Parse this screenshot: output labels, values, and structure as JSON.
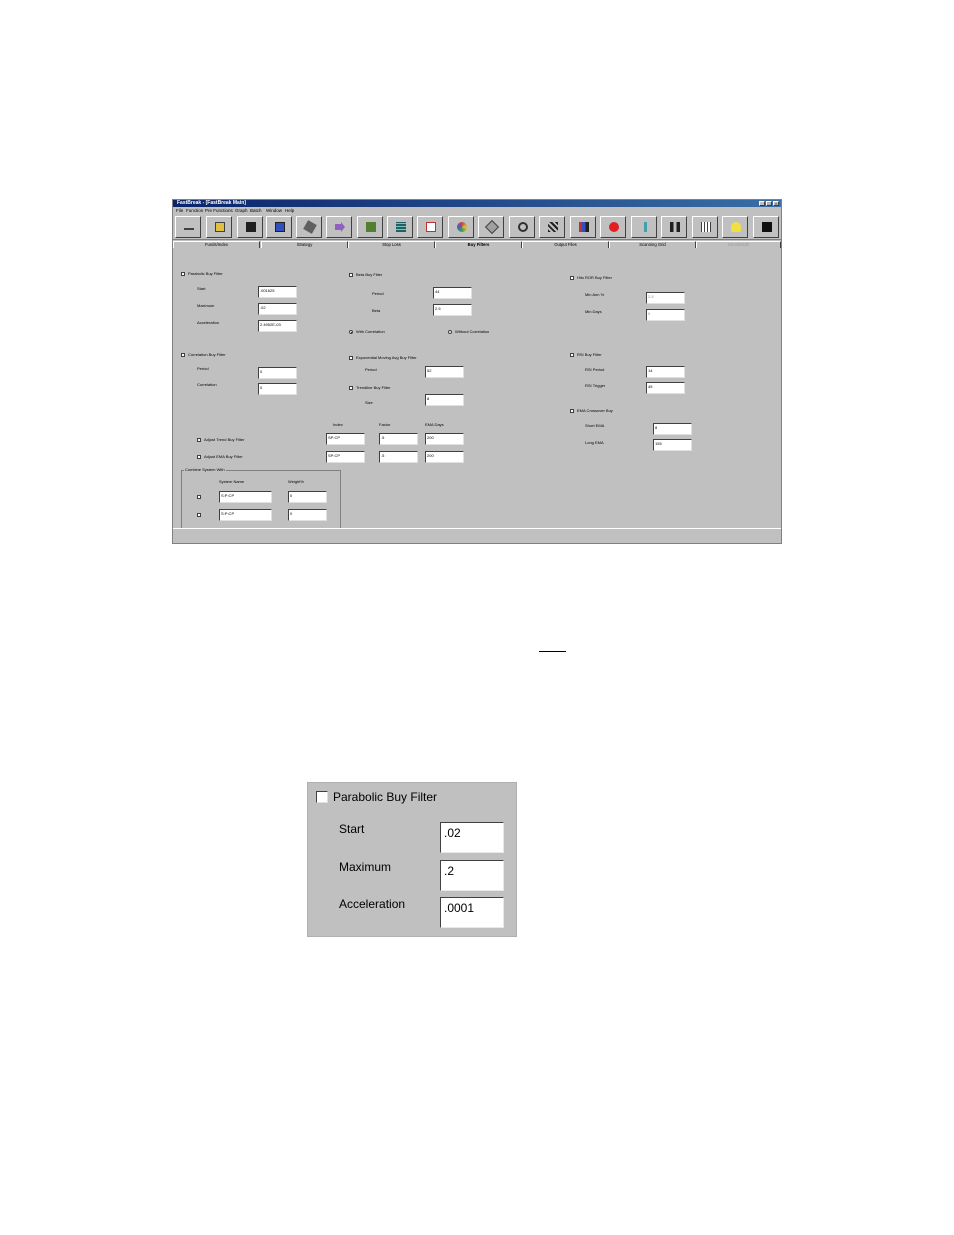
{
  "window": {
    "title": "FastBreak - [FastBreak Main]",
    "menu": [
      "File",
      "Function",
      "Pre Functions",
      "Graph",
      "Batch",
      "Window",
      "Help"
    ]
  },
  "toolbar": {
    "icons": [
      "minimize-icon",
      "open-icon",
      "save-icon",
      "run-icon",
      "copy-icon",
      "arrow-icon",
      "fund-icon",
      "grid-icon",
      "chart-icon",
      "color-wheel-icon",
      "diamond-icon",
      "gear-icon",
      "network-icon",
      "bars-icon",
      "stop-icon",
      "wrench-icon",
      "people-icon",
      "table-icon",
      "lightbulb-icon",
      "exit-icon"
    ],
    "colors": {
      "stop": "#e02020",
      "color_wheel": "#d04040"
    }
  },
  "tabs": [
    {
      "label": "Funds/Index"
    },
    {
      "label": "Strategy"
    },
    {
      "label": "Stop Loss"
    },
    {
      "label": "Buy Filters"
    },
    {
      "label": "Output Files"
    },
    {
      "label": "Scanning Grid"
    },
    {
      "label": "GeneticEdit"
    }
  ],
  "panel": {
    "parabolic": {
      "label": "Parabolic Buy Filter",
      "start_label": "Start",
      "start": ".001625",
      "maximum_label": "Maximum",
      "maximum": ".02",
      "accel_label": "Acceleration",
      "accel": "2.4952E-03"
    },
    "correlation": {
      "label": "Correlation Buy Filter",
      "period_label": "Period",
      "period": "0",
      "correlation_label": "Correlation",
      "correlation": "0"
    },
    "beta": {
      "label": "Beta Buy Filter",
      "period_label": "Period",
      "period": "44",
      "beta_label": "Beta",
      "beta": "2.5",
      "with_corr": "With Correlation",
      "without_corr": "Without Correlation"
    },
    "ema": {
      "label": "Exponential Moving Avg Buy Filter",
      "period_label": "Period",
      "period": "52"
    },
    "trendline": {
      "label": "Trendline Buy Filter",
      "size_label": "Size",
      "size": "8"
    },
    "adjust": {
      "index_label": "Index",
      "factor_label": "Factor",
      "ema_days_label": "EMA Days",
      "trend_label": "Adjust Trend Buy Filter",
      "trend_index": "SP:CP",
      "trend_factor": ".5",
      "trend_days": "200",
      "ema_label": "Adjust EMA Buy Filter",
      "ema_index": "SP:CP",
      "ema_factor": ".5",
      "ema_days": "200"
    },
    "combine": {
      "label": "Combine System With",
      "system_label": "System Name",
      "weight_label": "Weight%",
      "rows": [
        {
          "system": "S:P:CP",
          "weight": "0"
        },
        {
          "system": "S:P:CP",
          "weight": "0"
        }
      ]
    },
    "hiror": {
      "label": "Hilo ROR Buy Filter",
      "minann_label": "Min Ann %",
      "minann": "2.5",
      "mindays_label": "Min Days",
      "mindays": "0"
    },
    "rsi": {
      "label": "RSI Buy Filter",
      "period_label": "RSI Period",
      "period": "14",
      "trigger_label": "RSI Trigger",
      "trigger": "45"
    },
    "emacross": {
      "label": "EMA Crossover Buy",
      "short_label": "Short EMA",
      "short": "8",
      "long_label": "Long EMA",
      "long": "155"
    }
  },
  "zoom": {
    "label": "Parabolic Buy Filter",
    "start_label": "Start",
    "start": ".02",
    "maximum_label": "Maximum",
    "maximum": ".2",
    "accel_label": "Acceleration",
    "accel": ".0001"
  }
}
